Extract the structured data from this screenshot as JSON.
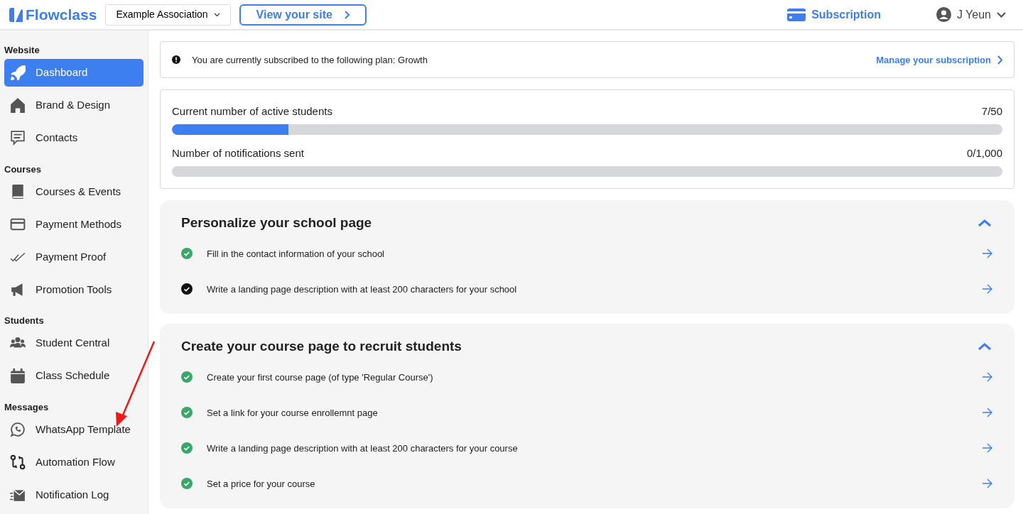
{
  "header": {
    "logo": "Flowclass",
    "org_select": "Example Association",
    "view_site": "View your site",
    "subscription": "Subscription",
    "user": "J Yeun"
  },
  "sidebar": {
    "groups": [
      {
        "title": "Website",
        "items": [
          {
            "label": "Dashboard",
            "selected": true
          },
          {
            "label": "Brand & Design",
            "selected": false
          },
          {
            "label": "Contacts",
            "selected": false
          }
        ]
      },
      {
        "title": "Courses",
        "items": [
          {
            "label": "Courses & Events",
            "selected": false
          },
          {
            "label": "Payment Methods",
            "selected": false
          },
          {
            "label": "Payment Proof",
            "selected": false
          },
          {
            "label": "Promotion Tools",
            "selected": false
          }
        ]
      },
      {
        "title": "Students",
        "items": [
          {
            "label": "Student Central",
            "selected": false
          },
          {
            "label": "Class Schedule",
            "selected": false
          }
        ]
      },
      {
        "title": "Messages",
        "items": [
          {
            "label": "WhatsApp Template",
            "selected": false
          },
          {
            "label": "Automation Flow",
            "selected": false
          },
          {
            "label": "Notification Log",
            "selected": false
          }
        ]
      }
    ]
  },
  "plan_notice": {
    "text": "You are currently subscribed to the following plan: Growth",
    "link": "Manage your subscription"
  },
  "usage": [
    {
      "label": "Current number of active students",
      "reading": "7/50",
      "level": 0.14
    },
    {
      "label": "Number of notifications sent",
      "reading": "0/1,000",
      "level": 0
    }
  ],
  "sections": [
    {
      "title": "Personalize your school page",
      "expanded": true,
      "tasks": [
        {
          "text": "Fill in the contact information of your school",
          "completed": true
        },
        {
          "text": "Write a landing page description with at least 200 characters for your school",
          "completed": false
        }
      ]
    },
    {
      "title": "Create your course page to recruit students",
      "expanded": true,
      "tasks": [
        {
          "text": "Create your first course page (of type 'Regular Course')",
          "completed": true
        },
        {
          "text": "Set a link for your course enrollemnt page",
          "completed": true
        },
        {
          "text": "Write a landing page description with at least 200 characters for your course",
          "completed": true
        },
        {
          "text": "Set a price for your course",
          "completed": true
        }
      ]
    }
  ]
}
